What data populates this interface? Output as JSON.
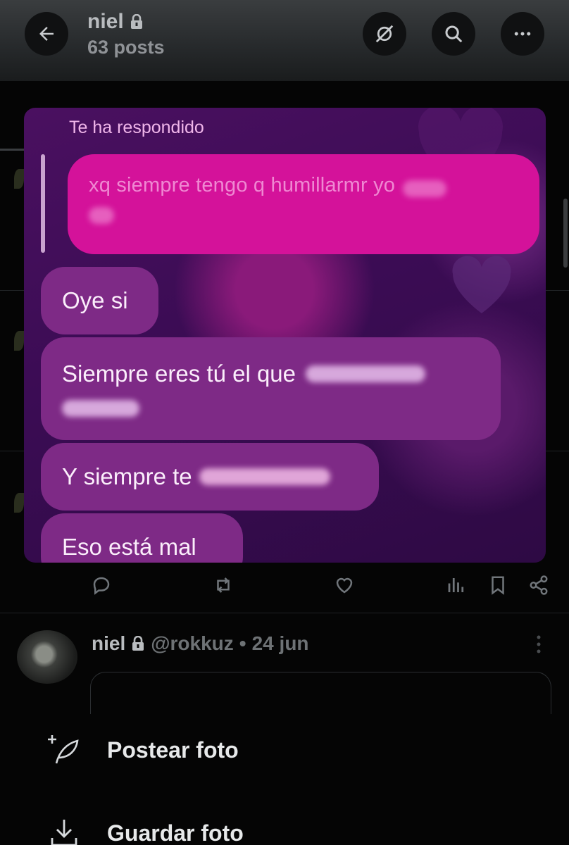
{
  "profile": {
    "name": "niel",
    "posts": "63 posts"
  },
  "story_reply": {
    "label": "Te ha respondido",
    "quoted_text": "xq siempre tengo q humillarmr yo",
    "messages": [
      "Oye si",
      "Siempre eres tú el que",
      "Y siempre te",
      "Eso está mal"
    ],
    "colors": {
      "quoted_bubble": "#d4129a",
      "reply_bubble": "#7e2a86",
      "label": "#f0b6ea"
    }
  },
  "tweet": {
    "name": "niel",
    "handle": "@rokkuz",
    "separator": "•",
    "date": "24 jun"
  },
  "sheet": {
    "post_photo": "Postear foto",
    "save_photo": "Guardar foto"
  },
  "icons": [
    "arrow-left-icon",
    "no-recommendations-icon",
    "search-icon",
    "more-horizontal-icon",
    "lock-icon",
    "reply-icon",
    "repost-icon",
    "like-icon",
    "views-icon",
    "bookmark-icon",
    "share-icon",
    "feather-plus-icon",
    "download-icon"
  ]
}
